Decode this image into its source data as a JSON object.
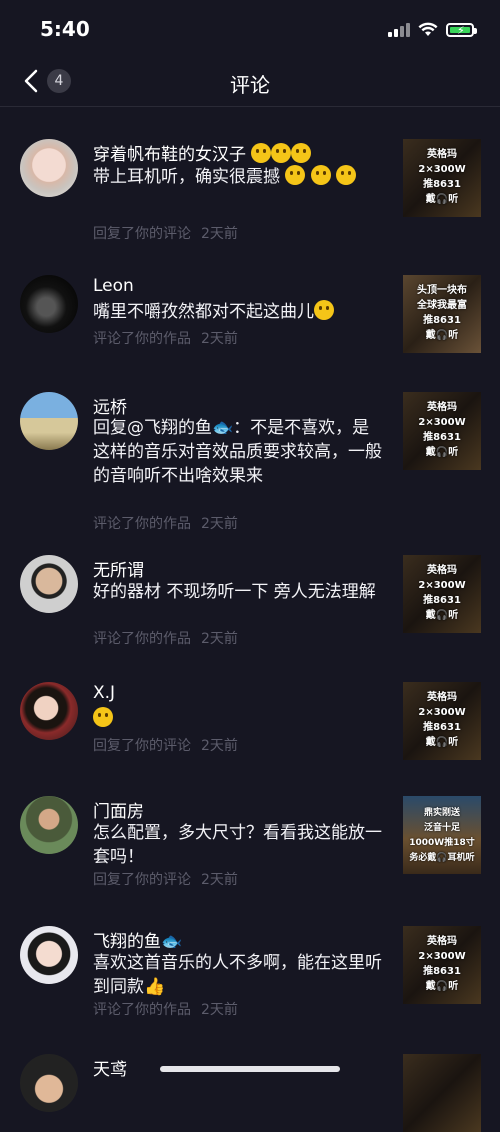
{
  "status": {
    "time": "5:40"
  },
  "header": {
    "title": "评论",
    "badge": "4"
  },
  "comments": [
    {
      "name": "穿着帆布鞋的女汉子",
      "text": "带上耳机听，确实很震撼",
      "action": "回复了你的评论",
      "time": "2天前",
      "thumb": "英格玛\n2×300W\n推8631\n戴🎧听"
    },
    {
      "name": "Leon",
      "text": "嘴里不嚼孜然都对不起这曲儿",
      "action": "评论了你的作品",
      "time": "2天前",
      "thumb": "头顶一块布\n全球我最富\n推8631\n戴🎧听"
    },
    {
      "name": "远桥",
      "text": "回复@飞翔的鱼🐟：不是不喜欢，是这样的音乐对音效品质要求较高，一般的音响听不出啥效果来",
      "action": "评论了你的作品",
      "time": "2天前",
      "thumb": "英格玛\n2×300W\n推8631\n戴🎧听"
    },
    {
      "name": "无所谓",
      "text": "好的器材 不现场听一下 旁人无法理解",
      "action": "评论了你的作品",
      "time": "2天前",
      "thumb": "英格玛\n2×300W\n推8631\n戴🎧听"
    },
    {
      "name": "X.J",
      "text": "",
      "action": "回复了你的评论",
      "time": "2天前",
      "thumb": "英格玛\n2×300W\n推8631\n戴🎧听"
    },
    {
      "name": "门面房",
      "text": "怎么配置，多大尺寸？看看我这能放一套吗！",
      "action": "回复了你的评论",
      "time": "2天前",
      "thumb": "鼎实刚送\n泛音十足\n1000W推18寸\n务必戴🎧耳机听"
    },
    {
      "name": "飞翔的鱼🐟",
      "text": "喜欢这首音乐的人不多啊，能在这里听到同款👍",
      "action": "评论了你的作品",
      "time": "2天前",
      "thumb": "英格玛\n2×300W\n推8631\n戴🎧听"
    },
    {
      "name": "天鸢",
      "text": "",
      "action": "",
      "time": "",
      "thumb": ""
    }
  ]
}
